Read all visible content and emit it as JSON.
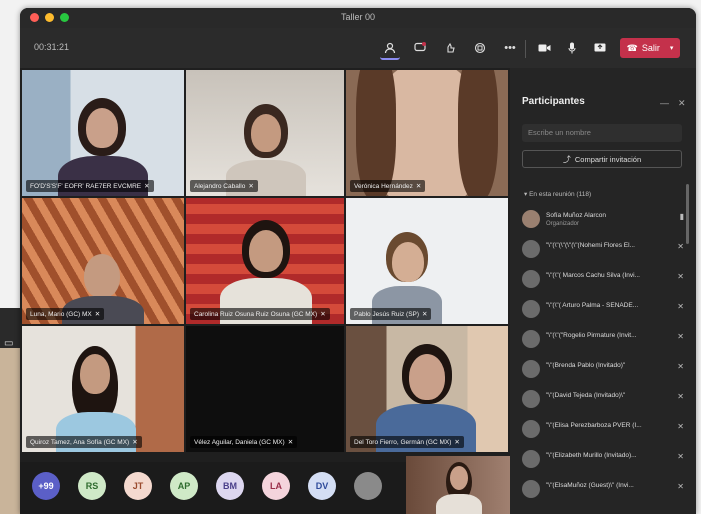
{
  "window": {
    "title": "Taller 00"
  },
  "toolbar": {
    "timer": "00:31:21",
    "leave_label": "Salir"
  },
  "tiles": [
    {
      "name": "FO'D'S'S'F' EOFR' RAE7ER EVCMRE"
    },
    {
      "name": "Alejandro Caballo"
    },
    {
      "name": "Verónica Hernández"
    },
    {
      "name": "Luna, Mario (GC) MX"
    },
    {
      "name": "Carolina Ruiz Osuna Ruiz Osuna (GC MX)"
    },
    {
      "name": "Pablo Jesús Ruiz (SP)"
    },
    {
      "name": "Quiroz Tamez, Ana Sofía (GC MX)"
    },
    {
      "name": "Vélez Aguilar, Daniela (GC MX)"
    },
    {
      "name": "Del Toro Fierro, Germán (GC MX)"
    }
  ],
  "bottom_avatars": [
    {
      "initials": "+99",
      "color": "#5b5fc7",
      "text_color": "#ffffff"
    },
    {
      "initials": "RS",
      "color": "#cfe9c7",
      "text_color": "#2e6b2e"
    },
    {
      "initials": "JT",
      "color": "#f4d9cf",
      "text_color": "#9a4a2e"
    },
    {
      "initials": "AP",
      "color": "#cfe9c7",
      "text_color": "#2e6b2e"
    },
    {
      "initials": "BM",
      "color": "#ddd7f0",
      "text_color": "#4a3f8a"
    },
    {
      "initials": "LA",
      "color": "#f4d4dc",
      "text_color": "#9a2e4a"
    },
    {
      "initials": "DV",
      "color": "#d4def4",
      "text_color": "#2e4a9a"
    },
    {
      "initials": "",
      "color": "#8a8a8a",
      "text_color": "#ffffff"
    }
  ],
  "panel": {
    "title": "Participantes",
    "search_placeholder": "Escribe un nombre",
    "share_label": "Compartir invitación",
    "section_label": "En esta reunión (118)",
    "participants": [
      {
        "name": "Sofía Muñoz Alarcon",
        "role": "Organizador"
      },
      {
        "name": "\"\\\"(\\\"(\\\"(\\\"(\\\"(Nohemi Flores El...",
        "role": ""
      },
      {
        "name": "\"\\\"(\\\"( Marcos Cachu Silva (Invi...",
        "role": ""
      },
      {
        "name": "\"\\\"(\\\"( Arturo Palma - SENADE...",
        "role": ""
      },
      {
        "name": "\"\\\"(\\\"(\"Rogelio Pirmature (Invit...",
        "role": ""
      },
      {
        "name": "\"\\\"(Brenda Pablo (Invitado)\"",
        "role": ""
      },
      {
        "name": "\"\\\"(David Tejeda (Invitado)\\\"",
        "role": ""
      },
      {
        "name": "\"\\\"(Elisa Perezbarboza PVER (I...",
        "role": ""
      },
      {
        "name": "\"\\\"(Elizabeth Murillo (Invitado)...",
        "role": ""
      },
      {
        "name": "\"\\\"(ElsaMuñoz (Guest)\\\" (Invi...",
        "role": ""
      }
    ]
  },
  "colors": {
    "accent": "#5b5fc7",
    "leave": "#c4314b"
  }
}
